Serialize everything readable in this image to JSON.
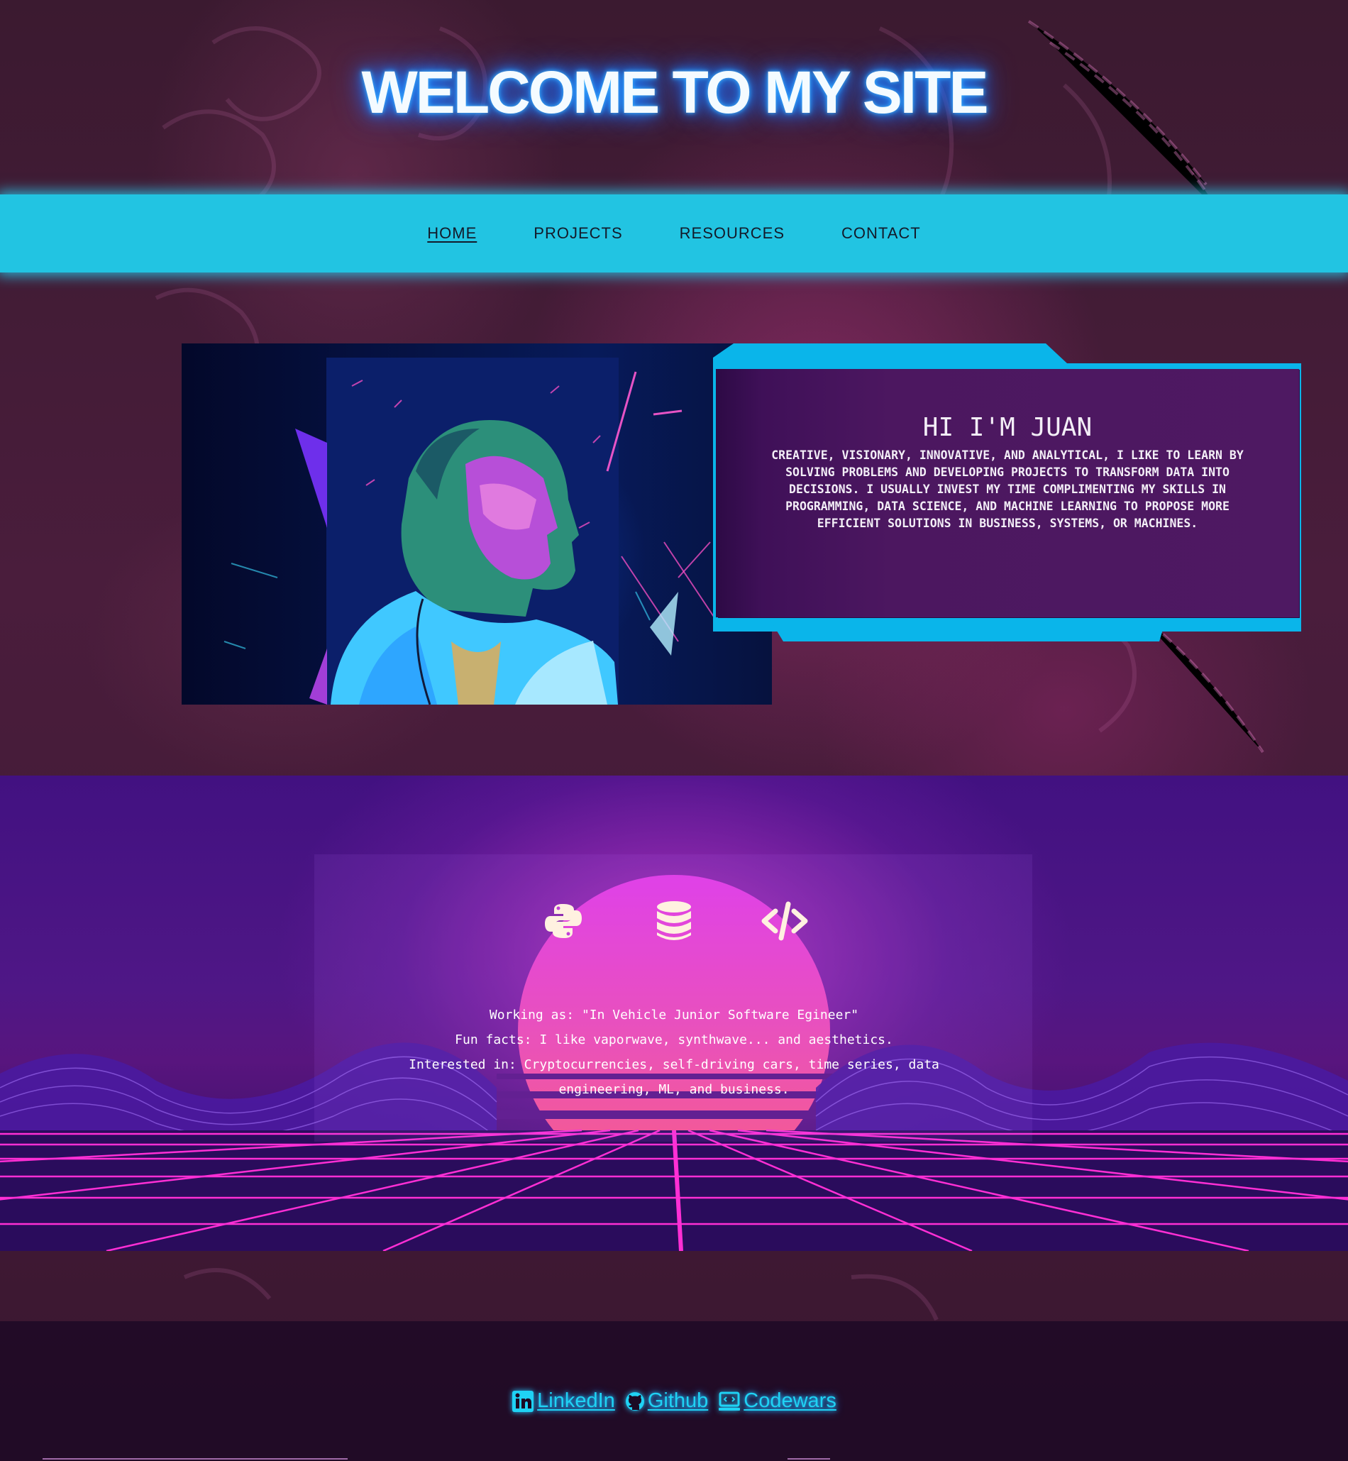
{
  "header": {
    "title": "WELCOME TO MY SITE"
  },
  "nav": {
    "items": [
      {
        "label": "HOME",
        "active": true
      },
      {
        "label": "PROJECTS",
        "active": false
      },
      {
        "label": "RESOURCES",
        "active": false
      },
      {
        "label": "CONTACT",
        "active": false
      }
    ]
  },
  "hero": {
    "heading": "HI I'M JUAN",
    "bio": "CREATIVE, VISIONARY, INNOVATIVE, AND ANALYTICAL, I LIKE TO LEARN BY SOLVING PROBLEMS AND DEVELOPING PROJECTS TO TRANSFORM DATA INTO DECISIONS. I USUALLY INVEST MY TIME COMPLIMENTING MY SKILLS IN PROGRAMMING, DATA SCIENCE, AND MACHINE LEARNING TO PROPOSE MORE EFFICIENT SOLUTIONS IN BUSINESS, SYSTEMS, OR MACHINES."
  },
  "skills": {
    "icons": [
      "python-icon",
      "database-icon",
      "code-icon"
    ],
    "lines": [
      "Working as: \"In Vehicle Junior Software Egineer\"",
      "Fun facts: I like vaporwave, synthwave... and aesthetics.",
      "Interested in: Cryptocurrencies, self-driving cars, time series, data engineering, ML, and business."
    ]
  },
  "footer": {
    "links": [
      {
        "label": "LinkedIn",
        "icon": "linkedin-icon"
      },
      {
        "label": "Github",
        "icon": "github-icon"
      },
      {
        "label": "Codewars",
        "icon": "codewars-icon"
      }
    ]
  },
  "colors": {
    "nav_bg": "#22c4e2",
    "neon_blue": "#1fd2f4",
    "frame_blue": "#0ab5ea",
    "synth_pink": "#ff3fd0"
  }
}
